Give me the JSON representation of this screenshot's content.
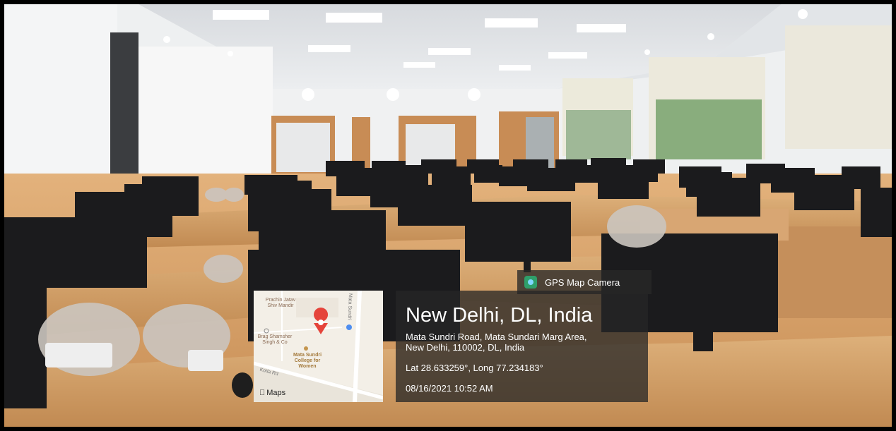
{
  "overlay": {
    "app_name": "GPS Map Camera",
    "city": "New Delhi, DL, India",
    "address_line1": "Mata Sundri Road, Mata Sundari Marg Area,",
    "address_line2": "New Delhi, 110002, DL, India",
    "coordinates": "Lat 28.633259°, Long 77.234183°",
    "timestamp": "08/16/2021 10:52 AM"
  },
  "map": {
    "brand": "Maps",
    "places": [
      {
        "line1": "Prachin Jatav",
        "line2": "Shiv Mandir"
      },
      {
        "line1": "Brag Shamsher",
        "line2": "Singh & Co"
      },
      {
        "line1": "Mata Sundri",
        "line2": "College for",
        "line3": "Women"
      }
    ],
    "roads": [
      "Mata Sundri",
      "Kotla Rd"
    ]
  },
  "colors": {
    "overlay_bg": "#262626",
    "marker": "#e5443b",
    "desk": "#d4a06b",
    "monitor": "#1b1b1d"
  }
}
